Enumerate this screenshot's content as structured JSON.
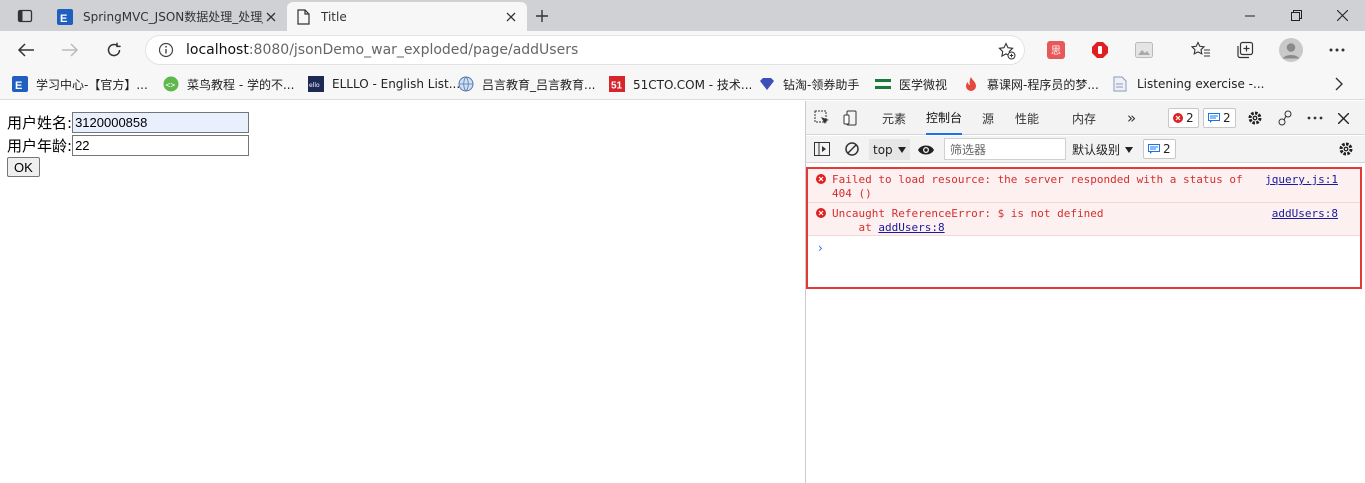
{
  "tabs": [
    {
      "title": "SpringMVC_JSON数据处理_处理JS",
      "active": false
    },
    {
      "title": "Title",
      "active": true
    }
  ],
  "address": {
    "host": "localhost",
    "path": ":8080/jsonDemo_war_exploded/page/addUsers"
  },
  "bookmarks": [
    {
      "label": "学习中心-【官方】..."
    },
    {
      "label": "菜鸟教程 - 学的不..."
    },
    {
      "label": "ELLLO - English List..."
    },
    {
      "label": "吕言教育_吕言教育..."
    },
    {
      "label": "51CTO.COM - 技术..."
    },
    {
      "label": "钻淘-领券助手"
    },
    {
      "label": "医学微视"
    },
    {
      "label": "慕课网-程序员的梦..."
    },
    {
      "label": "Listening exercise -..."
    }
  ],
  "form": {
    "name_label": "用户姓名:",
    "name_value": "3120000858",
    "age_label": "用户年龄:",
    "age_value": "22",
    "ok_label": "OK"
  },
  "devtools": {
    "tabs": [
      "元素",
      "控制台",
      "源",
      "性能",
      "内存"
    ],
    "more": "»",
    "error_count": "2",
    "message_count": "2",
    "context": "top",
    "filter_placeholder": "筛选器",
    "level": "默认级别",
    "level_count": "2",
    "messages": [
      {
        "text_line1": "Failed to load resource: the server responded with a status of",
        "text_line2": "404 ()",
        "source": "jquery.js:1"
      },
      {
        "text_line1": "Uncaught ReferenceError: $ is not defined",
        "text_line2_prefix": "    at ",
        "text_line2_link": "addUsers:8",
        "source": "addUsers:8"
      }
    ],
    "prompt": "›"
  },
  "colors": {
    "accent": "#1a73e8",
    "error": "#d32f2f",
    "highlight": "#e53935"
  }
}
